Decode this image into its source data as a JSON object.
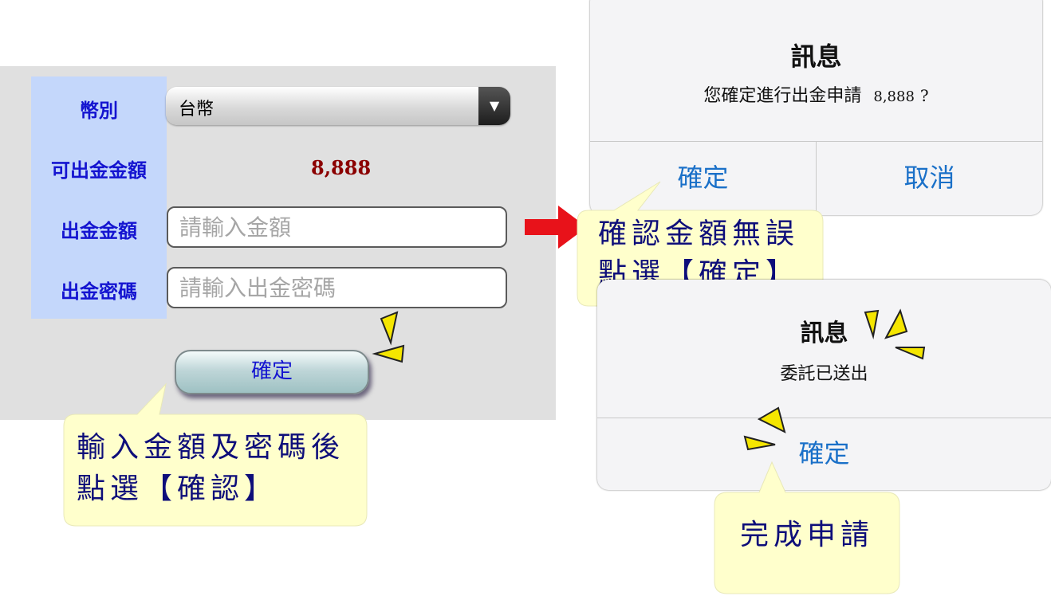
{
  "form": {
    "currency_label": "幣別",
    "currency_value": "台幣",
    "available_label": "可出金金額",
    "available_value": "8,888",
    "amount_label": "出金金額",
    "amount_placeholder": "請輸入金額",
    "password_label": "出金密碼",
    "password_placeholder": "請輸入出金密碼",
    "confirm_label": "確定"
  },
  "callouts": {
    "step1_line1": "輸入金額及密碼後",
    "step1_line2": "點選【確認】",
    "step2_line1": "確認金額無誤",
    "step2_line2": "點選【確定】",
    "step3": "完成申請"
  },
  "dialog_confirm": {
    "title": "訊息",
    "message": "您確定進行出金申請",
    "amount": "8,888",
    "question": "?",
    "ok_label": "確定",
    "cancel_label": "取消"
  },
  "dialog_done": {
    "title": "訊息",
    "message": "委託已送出",
    "ok_label": "確定"
  },
  "colors": {
    "panel_bg": "#e0e0e0",
    "label_col_bg": "#c4d7fb",
    "label_text": "#1414d0",
    "amount_text": "#8b0000",
    "callout_bg": "#ffffcc",
    "dialog_button": "#1a70c8",
    "arrow": "#e8121a",
    "accent_marks": "#f5e600"
  }
}
